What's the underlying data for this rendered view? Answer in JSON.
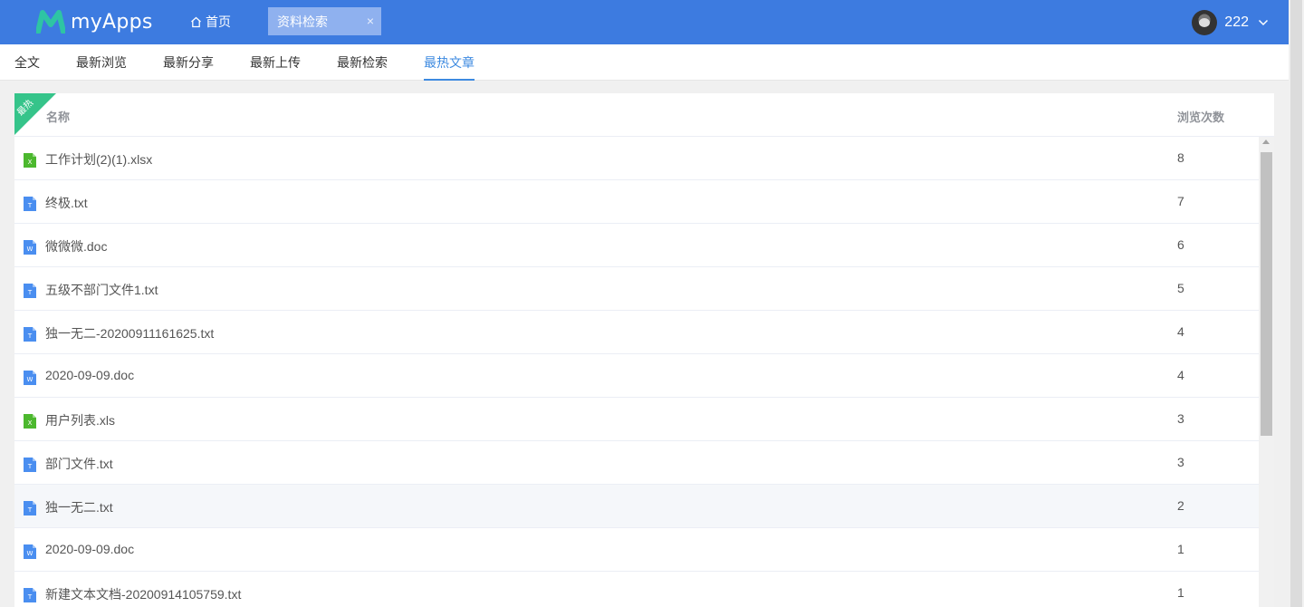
{
  "app": {
    "name": "myApps"
  },
  "header": {
    "home_label": "首页",
    "open_tab_label": "资料检索",
    "close_glyph": "×",
    "user_name": "222"
  },
  "subnav": {
    "tabs": [
      {
        "label": "全文",
        "active": false
      },
      {
        "label": "最新浏览",
        "active": false
      },
      {
        "label": "最新分享",
        "active": false
      },
      {
        "label": "最新上传",
        "active": false
      },
      {
        "label": "最新检索",
        "active": false
      },
      {
        "label": "最热文章",
        "active": true
      }
    ]
  },
  "table": {
    "corner_badge": "最热",
    "columns": {
      "name": "名称",
      "count": "浏览次数"
    },
    "rows": [
      {
        "type": "xlsx",
        "name": "工作计划(2)(1).xlsx",
        "count": "8"
      },
      {
        "type": "txt",
        "name": "终极.txt",
        "count": "7"
      },
      {
        "type": "doc",
        "name": "微微微.doc",
        "count": "6"
      },
      {
        "type": "txt",
        "name": "五级不部门文件1.txt",
        "count": "5"
      },
      {
        "type": "txt",
        "name": "独一无二-20200911161625.txt",
        "count": "4"
      },
      {
        "type": "doc",
        "name": "2020-09-09.doc",
        "count": "4"
      },
      {
        "type": "xlsx",
        "name": "用户列表.xls",
        "count": "3"
      },
      {
        "type": "txt",
        "name": "部门文件.txt",
        "count": "3"
      },
      {
        "type": "txt",
        "name": "独一无二.txt",
        "count": "2",
        "hovered": true
      },
      {
        "type": "doc",
        "name": "2020-09-09.doc",
        "count": "1"
      },
      {
        "type": "txt",
        "name": "新建文本文档-20200914105759.txt",
        "count": "1"
      }
    ]
  },
  "icons": {
    "xlsx": {
      "name": "excel-file-icon",
      "color": "#4cb82e",
      "letter": "X"
    },
    "txt": {
      "name": "text-file-icon",
      "color": "#4a8ef0",
      "letter": "T"
    },
    "doc": {
      "name": "word-file-icon",
      "color": "#4a8ef0",
      "letter": "W"
    }
  },
  "colors": {
    "brand": "#3d7be0",
    "active_tab": "#3d8ae0",
    "badge": "#35c48a"
  }
}
